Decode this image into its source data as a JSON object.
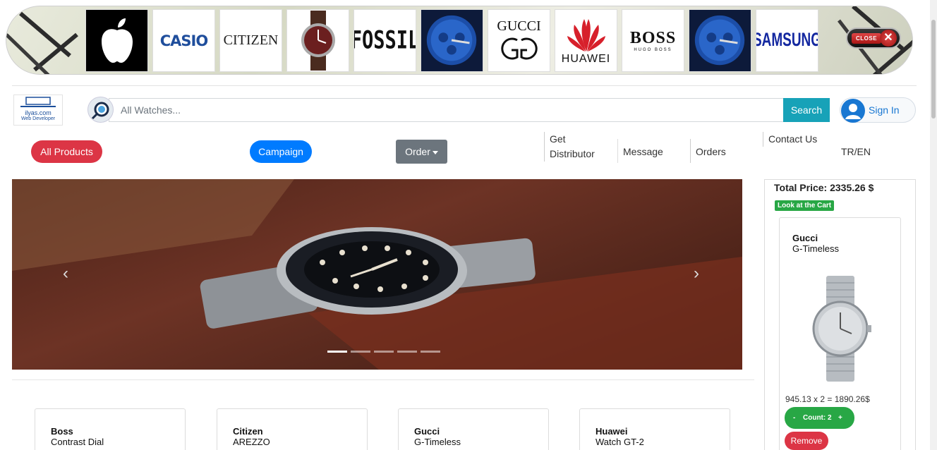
{
  "brands": {
    "close_label": "CLOSE",
    "items": [
      {
        "name": "Apple",
        "text": ""
      },
      {
        "name": "Casio",
        "text": "CASIO"
      },
      {
        "name": "Citizen",
        "text": "CITIZEN"
      },
      {
        "name": "Watch",
        "text": ""
      },
      {
        "name": "Fossil",
        "text": "FOSSIL"
      },
      {
        "name": "Blue watch",
        "text": ""
      },
      {
        "name": "Gucci",
        "text": "GUCCI"
      },
      {
        "name": "Huawei",
        "text": "HUAWEI"
      },
      {
        "name": "Boss",
        "text": "BOSS",
        "sub": "HUGO BOSS"
      },
      {
        "name": "Blue watch",
        "text": ""
      },
      {
        "name": "Samsung",
        "text": "SAMSUNG"
      }
    ]
  },
  "header": {
    "logo_title": "ilyas.com",
    "logo_sub": "Web Developer",
    "search_placeholder": "All Watches...",
    "search_button": "Search",
    "signin": "Sign In"
  },
  "nav": {
    "all_products": "All Products",
    "campaign": "Campaign",
    "order": "Order",
    "links": [
      {
        "label": "Get Distributor"
      },
      {
        "label": "Message"
      },
      {
        "label": "Orders"
      },
      {
        "label": "Contact Us"
      },
      {
        "label": "TR/EN"
      }
    ]
  },
  "carousel": {
    "prev": "‹",
    "next": "›",
    "active_slide": 1,
    "slide_count": 5
  },
  "products": [
    {
      "brand": "Boss",
      "model": "Contrast Dial"
    },
    {
      "brand": "Citizen",
      "model": "AREZZO"
    },
    {
      "brand": "Gucci",
      "model": "G-Timeless"
    },
    {
      "brand": "Huawei",
      "model": "Watch GT-2"
    }
  ],
  "cart": {
    "total": "Total Price: 2335.26 $",
    "look": "Look at the Cart",
    "item": {
      "brand": "Gucci",
      "model": "G-Timeless",
      "calc": "945.13 x 2 = 1890.26$",
      "minus": "-",
      "count": "Count: 2",
      "plus": "+",
      "remove": "Remove"
    }
  },
  "colors": {
    "primary": "#007bff",
    "danger": "#dc3545",
    "success": "#28a745",
    "info": "#17a2b8",
    "secondary": "#6c757d"
  }
}
